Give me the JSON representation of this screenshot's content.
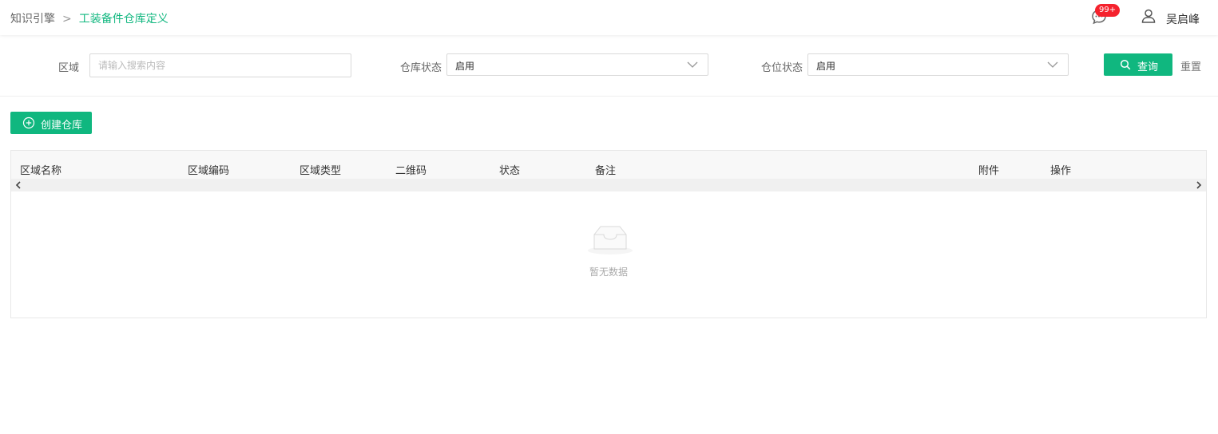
{
  "header": {
    "breadcrumb": {
      "root": "知识引擎",
      "separator": ">",
      "current": "工装备件仓库定义"
    },
    "notification": {
      "icon": "message-icon",
      "badge": "99+"
    },
    "user": {
      "icon": "user-icon",
      "name": "吴启峰"
    }
  },
  "filters": {
    "area": {
      "label": "区域",
      "placeholder": "请输入搜索内容",
      "value": ""
    },
    "warehouse_status": {
      "label": "仓库状态",
      "value": "启用"
    },
    "location_status": {
      "label": "仓位状态",
      "value": "启用"
    },
    "query_label": "查询",
    "reset_label": "重置"
  },
  "actions": {
    "create_label": "创建仓库"
  },
  "table": {
    "columns": [
      "区域名称",
      "区域编码",
      "区域类型",
      "二维码",
      "状态",
      "备注",
      "附件",
      "操作"
    ],
    "rows": [],
    "empty_text": "暂无数据"
  },
  "colors": {
    "accent": "#10b77f",
    "badge": "#f5222d"
  }
}
